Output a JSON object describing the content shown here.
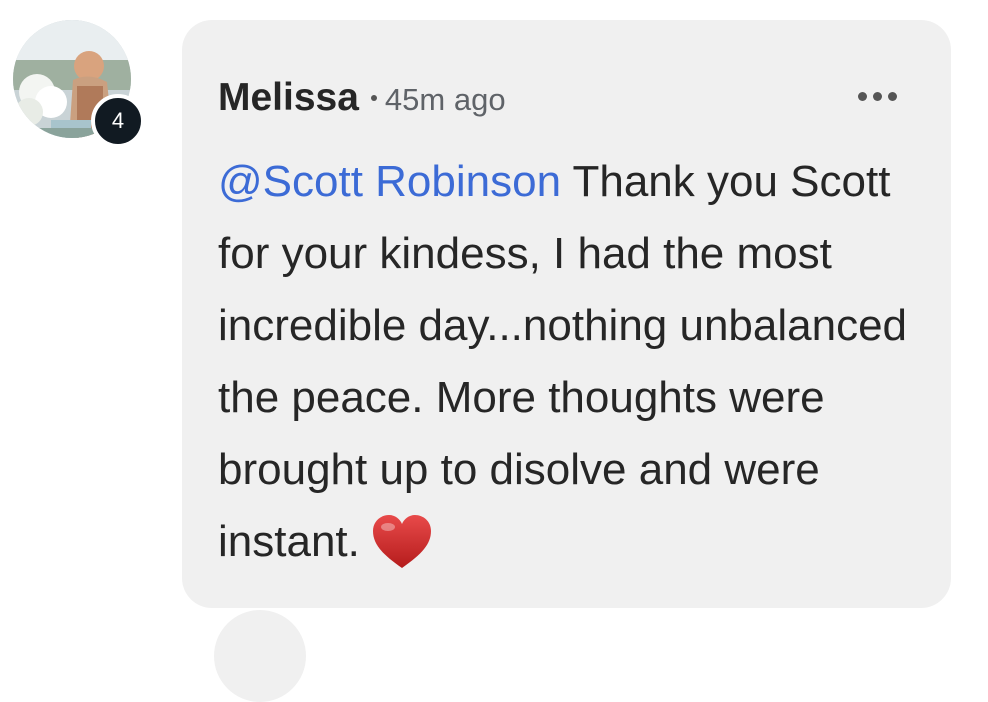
{
  "comment": {
    "author": "Melissa",
    "time_ago": "45m ago",
    "badge_count": "4",
    "mention": "@Scott Robinson",
    "text": " Thank you Scott for your kindess, I had the most incredible day...nothing unbalanced the peace. More thoughts were brought up to disolve and were instant.",
    "reaction_icon": "heart-emoji",
    "more_icon": "more-options-icon"
  },
  "colors": {
    "bubble_bg": "#f0f0f0",
    "mention": "#3c6bd6",
    "badge_bg": "#111a22",
    "heart": "#d32f2f"
  }
}
